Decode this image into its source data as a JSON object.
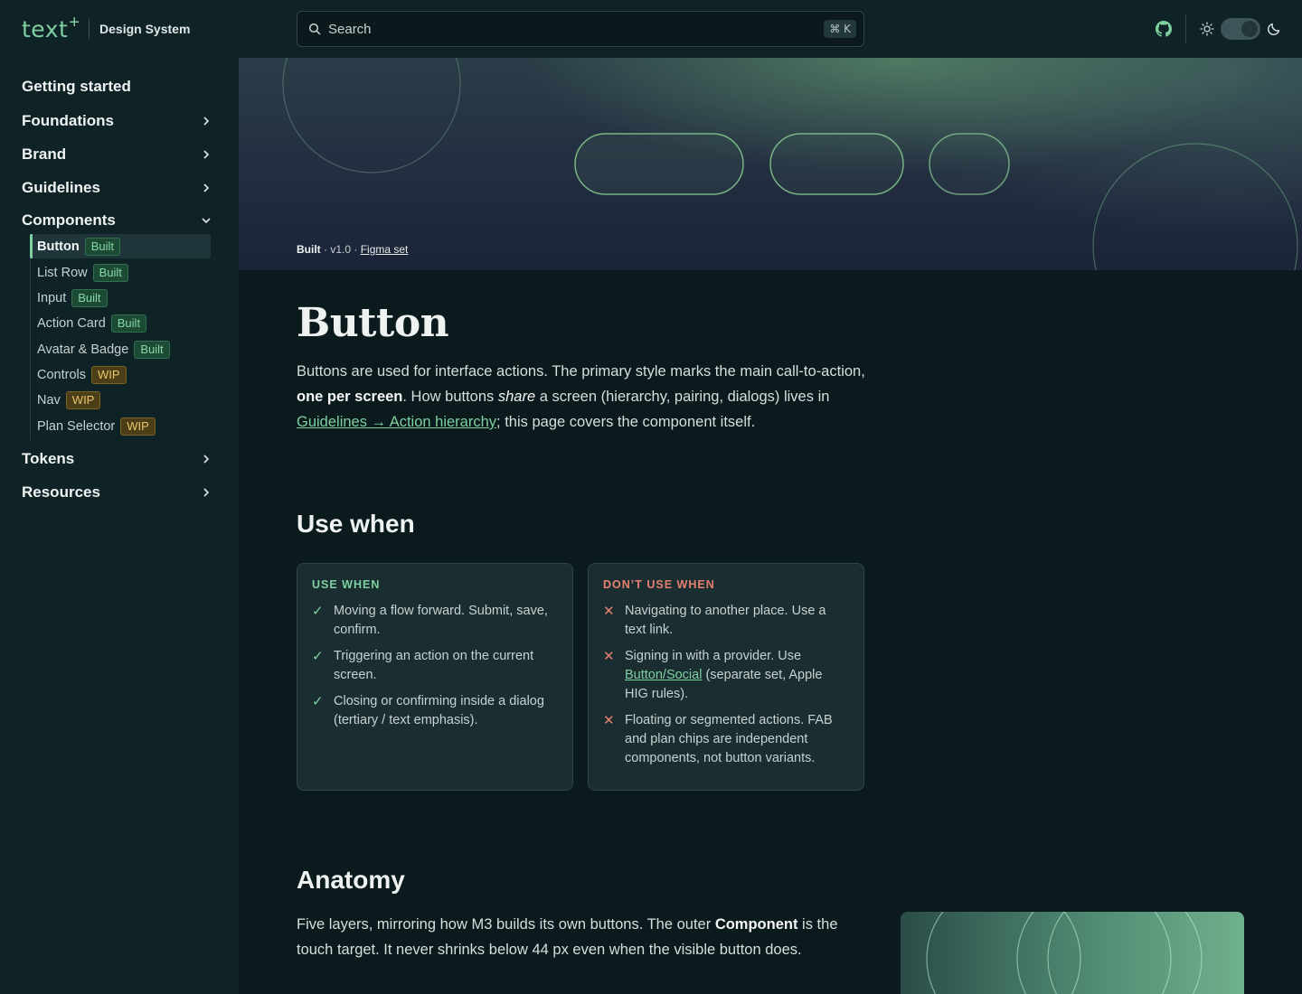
{
  "header": {
    "logo_text": "text",
    "logo_plus": "+",
    "logo_subtitle": "Design System",
    "search_placeholder": "Search",
    "search_shortcut": "⌘ K",
    "github_icon": "github-icon",
    "theme_icons": [
      "sun-icon",
      "moon-icon"
    ]
  },
  "sidebar": {
    "getting_started": "Getting started",
    "foundations": "Foundations",
    "brand": "Brand",
    "guidelines": "Guidelines",
    "components": "Components",
    "tokens": "Tokens",
    "resources": "Resources",
    "component_items": [
      {
        "label": "Button",
        "badge": "Built"
      },
      {
        "label": "List Row",
        "badge": "Built"
      },
      {
        "label": "Input",
        "badge": "Built"
      },
      {
        "label": "Action Card",
        "badge": "Built"
      },
      {
        "label": "Avatar & Badge",
        "badge": "Built"
      },
      {
        "label": "Controls",
        "badge": "WIP"
      },
      {
        "label": "Nav",
        "badge": "WIP"
      },
      {
        "label": "Plan Selector",
        "badge": "WIP"
      }
    ]
  },
  "hero": {
    "status": "Built",
    "sep1": " · ",
    "version": "v1.0",
    "sep2": " · ",
    "figma_link": "Figma set"
  },
  "page": {
    "title": "Button",
    "intro_1": "Buttons are used for interface actions. The primary style marks the main call-to-action, ",
    "intro_bold": "one per screen",
    "intro_2": ". How buttons ",
    "intro_italic": "share",
    "intro_3": " a screen (hierarchy, pairing, dialogs) lives in ",
    "intro_link": "Guidelines → Action hierarchy",
    "intro_4": "; this page covers the component itself.",
    "use_when_heading": "Use when",
    "anatomy_heading": "Anatomy",
    "anatomy_1": "Five layers, mirroring how M3 builds its own buttons. The outer ",
    "anatomy_bold": "Component",
    "anatomy_2": " is the touch target. It never shrinks below 44 px even when the visible button does."
  },
  "use_when": {
    "heading": "USE WHEN",
    "items": [
      "Moving a flow forward. Submit, save, confirm.",
      "Triggering an action on the current screen.",
      "Closing or confirming inside a dialog (tertiary / text emphasis)."
    ]
  },
  "dont_use_when": {
    "heading": "DON’T USE WHEN",
    "item1": "Navigating to another place. Use a text link.",
    "item2_a": "Signing in with a provider. Use ",
    "item2_link": "Button/Social",
    "item2_b": " (separate set, Apple HIG rules).",
    "item3": "Floating or segmented actions. FAB and plan chips are independent components, not button variants."
  },
  "colors": {
    "accent": "#7fd0a0",
    "danger": "#e8806f",
    "wip": "#e8c46a",
    "background": "#0a1a1d",
    "sidebar": "#0f2226"
  }
}
